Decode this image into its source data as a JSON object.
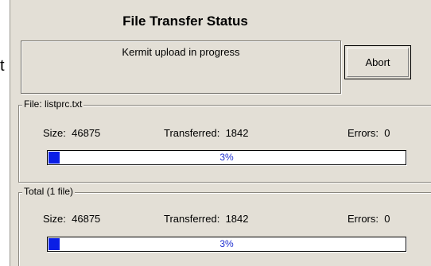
{
  "stray_char": "t",
  "dialog": {
    "title": "File Transfer Status",
    "status_text": "Kermit upload in progress",
    "abort_label": "Abort"
  },
  "file_group": {
    "legend": "File: listprc.txt",
    "size_label": "Size:",
    "size_value": "46875",
    "transferred_label": "Transferred:",
    "transferred_value": "1842",
    "errors_label": "Errors:",
    "errors_value": "0",
    "progress_text": "3%",
    "progress_fraction": 0.03
  },
  "total_group": {
    "legend": "Total (1 file)",
    "size_label": "Size:",
    "size_value": "46875",
    "transferred_label": "Transferred:",
    "transferred_value": "1842",
    "errors_label": "Errors:",
    "errors_value": "0",
    "progress_text": "3%",
    "progress_fraction": 0.03
  },
  "colors": {
    "dialog_bg": "#e3dfd6",
    "progress_fill": "#0a1ee6",
    "progress_text": "#1f2fd0"
  }
}
